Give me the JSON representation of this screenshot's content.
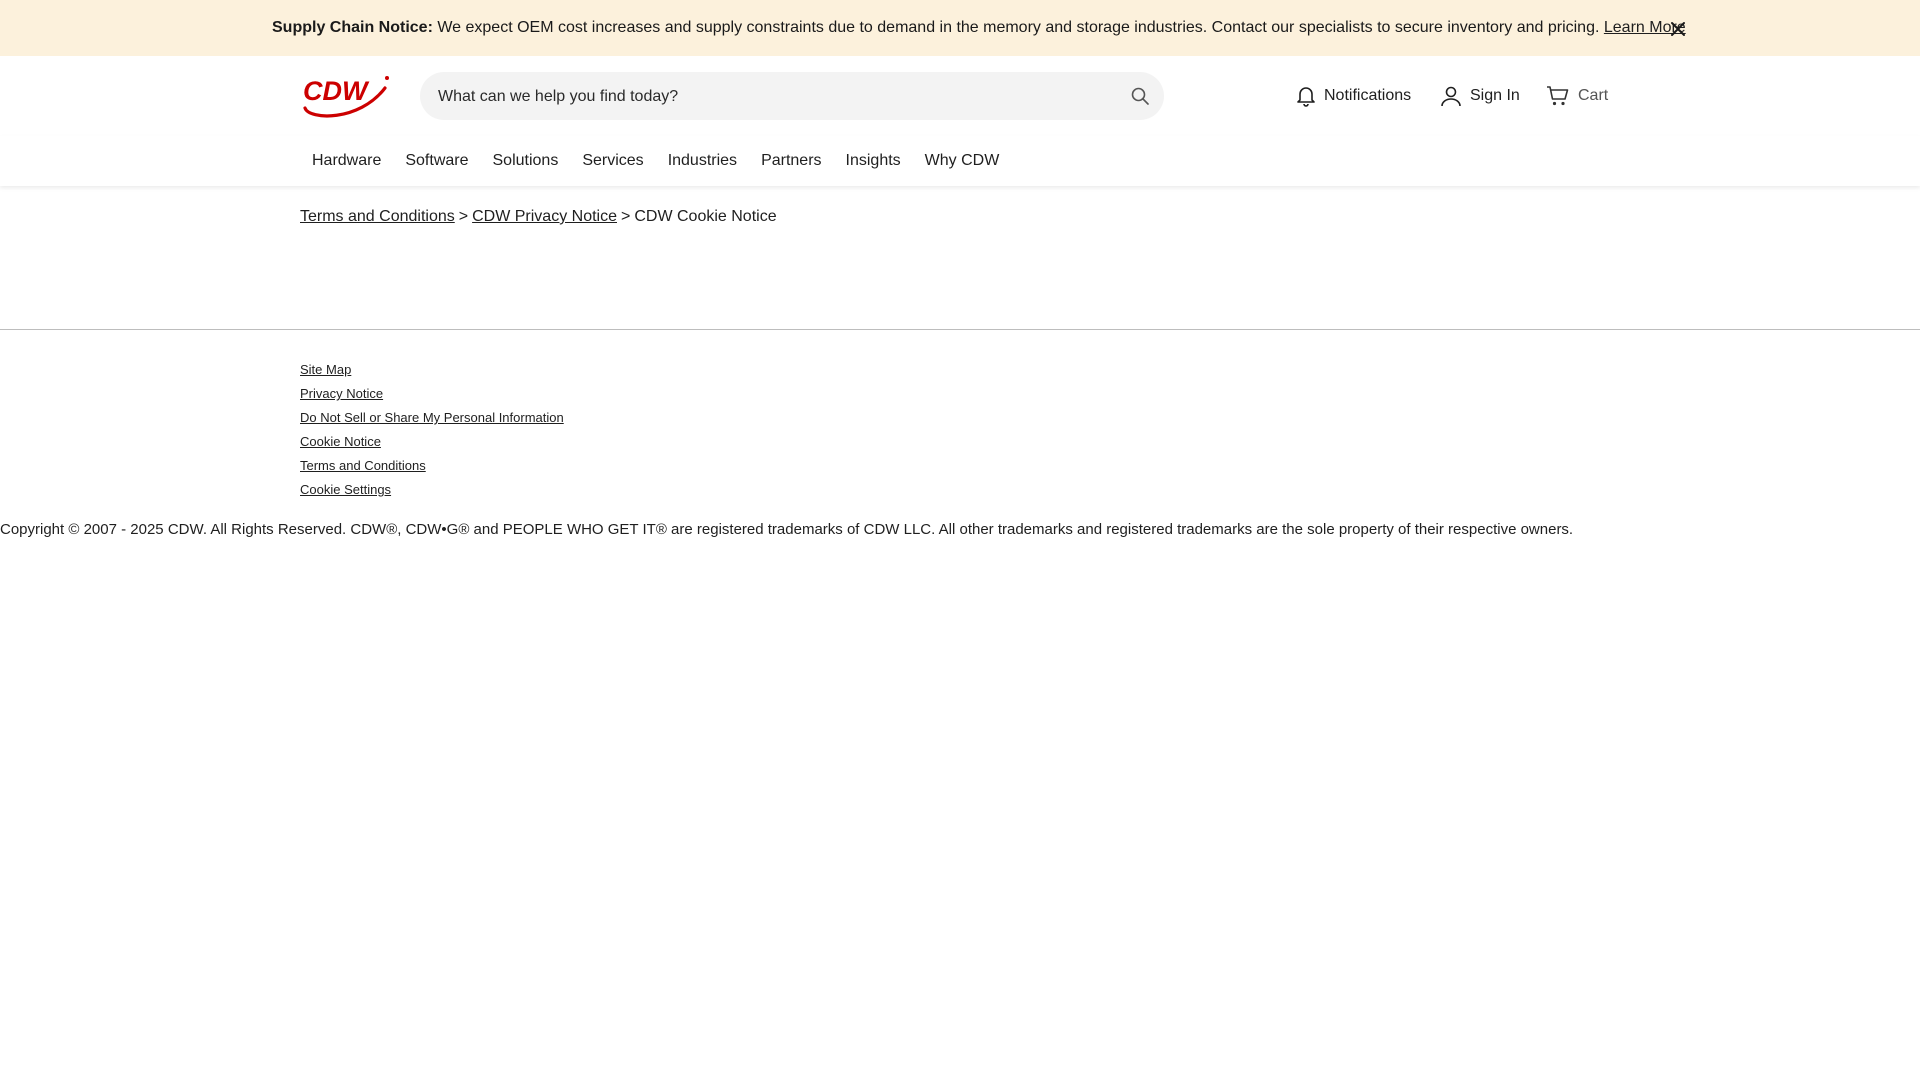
{
  "banner": {
    "title": "Supply Chain Notice:",
    "message": " We expect OEM cost increases and supply constraints due to demand in the memory and storage industries. Contact our specialists to secure inventory and pricing. ",
    "link": "Learn More",
    "close_icon": "close-icon"
  },
  "header": {
    "logo_text": "CDW",
    "search_placeholder": "What can we help you find today?",
    "notifications_label": "Notifications",
    "signin_label": "Sign In",
    "cart_label": "Cart"
  },
  "nav": {
    "items": [
      "Hardware",
      "Software",
      "Solutions",
      "Services",
      "Industries",
      "Partners",
      "Insights",
      "Why CDW"
    ]
  },
  "breadcrumb": {
    "items": [
      "Terms and Conditions",
      "CDW Privacy Notice",
      "CDW Cookie Notice"
    ],
    "separator": ">"
  },
  "footer": {
    "links": [
      "Site Map",
      "Privacy Notice",
      "Do Not Sell or Share My Personal Information",
      "Cookie Notice",
      "Terms and Conditions",
      "Cookie Settings"
    ],
    "copyright": "Copyright © 2007 - 2025 CDW. All Rights Reserved. CDW®, CDW•G® and PEOPLE WHO GET IT® are registered trademarks of CDW LLC. All other trademarks and registered trademarks are the sole property of their respective owners."
  },
  "colors": {
    "banner_bg": "#fcf1dc",
    "brand_red": "#cc0000"
  }
}
